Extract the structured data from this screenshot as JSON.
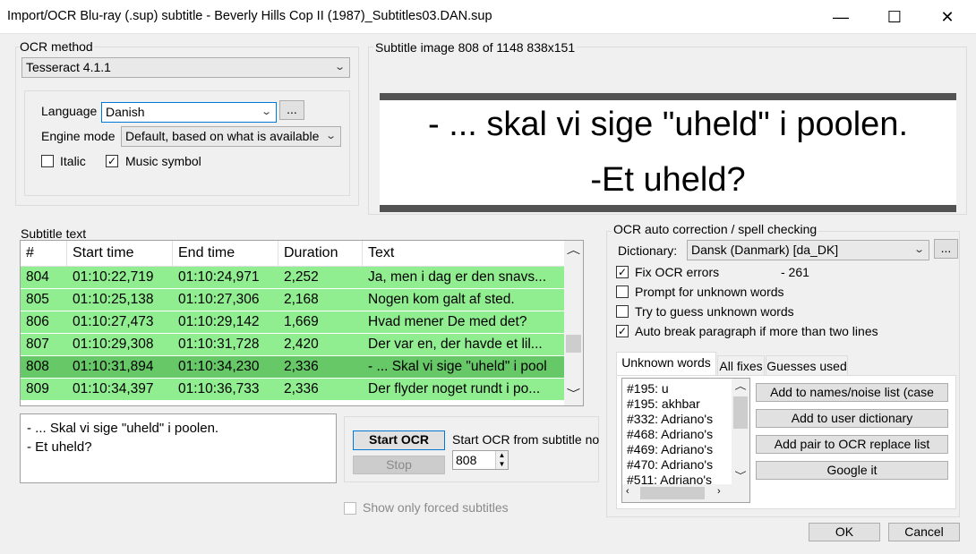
{
  "window": {
    "title": "Import/OCR Blu-ray (.sup) subtitle - Beverly Hills Cop II (1987)_Subtitles03.DAN.sup",
    "minimize_glyph": "—",
    "maximize_glyph": "☐",
    "close_glyph": "✕"
  },
  "ocr_method": {
    "label": "OCR method",
    "engine": "Tesseract 4.1.1",
    "language_label": "Language",
    "language": "Danish",
    "browse_label": "...",
    "engine_mode_label": "Engine mode",
    "engine_mode": "Default, based on what is available",
    "italic_label": "Italic",
    "italic_checked": false,
    "music_label": "Music symbol",
    "music_checked": true
  },
  "subtitle_image": {
    "label": "Subtitle image 808 of 1148   838x151",
    "lines": [
      "- ... skal vi sige \"uheld\" i poolen.",
      "-Et uheld?"
    ]
  },
  "subtitle_text": {
    "label": "Subtitle text",
    "columns": [
      "#",
      "Start time",
      "End time",
      "Duration",
      "Text"
    ],
    "rows": [
      {
        "num": "804",
        "start": "01:10:22,719",
        "end": "01:10:24,971",
        "duration": "2,252",
        "text": "Ja, men i dag er den snavs..."
      },
      {
        "num": "805",
        "start": "01:10:25,138",
        "end": "01:10:27,306",
        "duration": "2,168",
        "text": "Nogen kom galt af sted."
      },
      {
        "num": "806",
        "start": "01:10:27,473",
        "end": "01:10:29,142",
        "duration": "1,669",
        "text": "Hvad mener De med det?"
      },
      {
        "num": "807",
        "start": "01:10:29,308",
        "end": "01:10:31,728",
        "duration": "2,420",
        "text": "Der var en, der havde et lil..."
      },
      {
        "num": "808",
        "start": "01:10:31,894",
        "end": "01:10:34,230",
        "duration": "2,336",
        "text": "- ... Skal vi sige \"uheld\" i pool"
      },
      {
        "num": "809",
        "start": "01:10:34,397",
        "end": "01:10:36,733",
        "duration": "2,336",
        "text": "Der flyder noget rundt i po..."
      }
    ],
    "selected_row": "808",
    "current_text_lines": [
      "- ... Skal vi sige \"uheld\" i poolen.",
      "- Et uheld?"
    ]
  },
  "ocr_controls": {
    "start_label": "Start OCR",
    "stop_label": "Stop",
    "start_from_label": "Start OCR from subtitle no:",
    "start_from_value": "808",
    "forced_label": "Show only forced subtitles"
  },
  "spell": {
    "label": "OCR auto correction / spell checking",
    "dictionary_label": "Dictionary:",
    "dictionary": "Dansk (Danmark) [da_DK]",
    "browse_label": "...",
    "fix_ocr_label": "Fix OCR errors",
    "fix_ocr_checked": true,
    "fix_count": "- 261",
    "prompt_label": "Prompt for unknown words",
    "prompt_checked": false,
    "guess_label": "Try to guess unknown words",
    "guess_checked": false,
    "autobreak_label": "Auto break paragraph if more than two lines",
    "autobreak_checked": true,
    "tabs": [
      "Unknown words",
      "All fixes",
      "Guesses used"
    ],
    "unknown_words": [
      "#195: u",
      "#195: akhbar",
      "#332: Adriano's",
      "#468: Adriano's",
      "#469: Adriano's",
      "#470: Adriano's",
      "#511: Adriano's"
    ],
    "add_names_label": "Add to names/noise list (case",
    "add_user_dict_label": "Add to user dictionary",
    "add_pair_label": "Add pair to OCR replace list",
    "google_label": "Google it"
  },
  "footer": {
    "ok_label": "OK",
    "cancel_label": "Cancel"
  }
}
